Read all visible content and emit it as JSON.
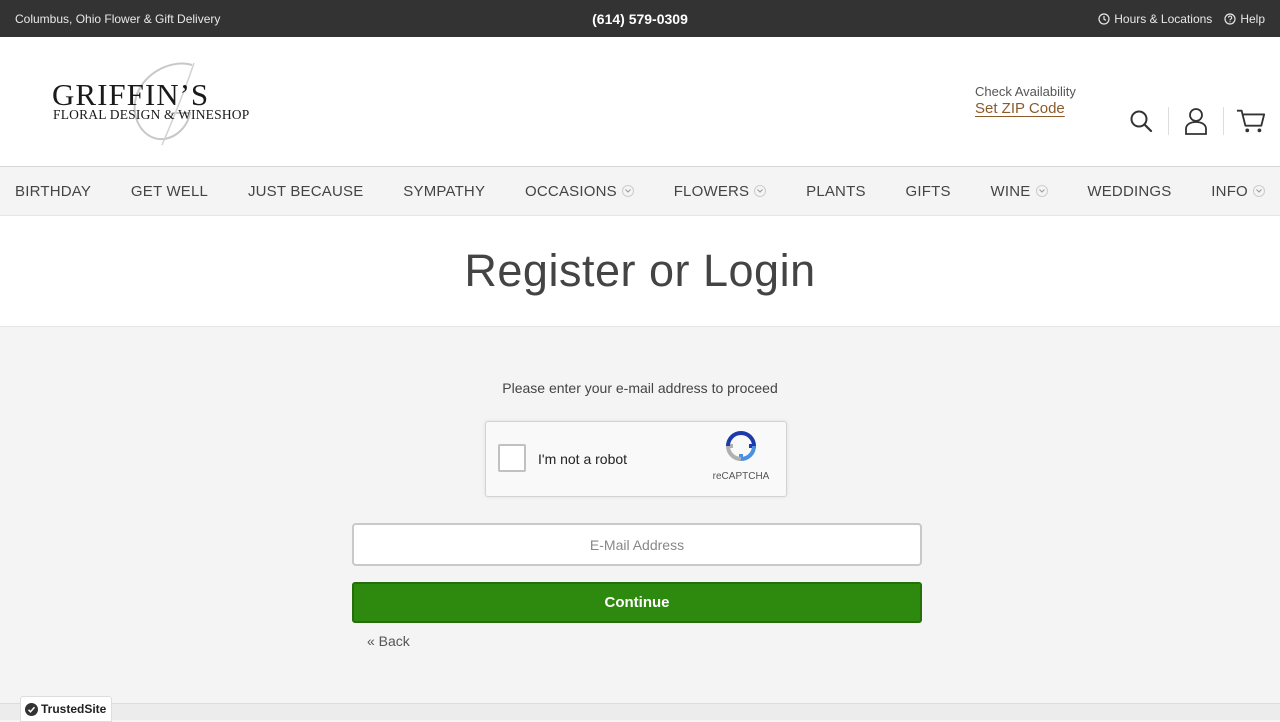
{
  "topbar": {
    "tagline": "Columbus, Ohio Flower & Gift Delivery",
    "phone": "(614) 579-0309",
    "hours_label": "Hours & Locations",
    "help_label": "Help"
  },
  "header": {
    "brand": "GRIFFIN’S",
    "brand_tagline": "FLORAL DESIGN & WINESHOP",
    "zip_label": "Check Availability",
    "zip_action": "Set ZIP Code",
    "icons": [
      "search-icon",
      "account-icon",
      "cart-icon"
    ]
  },
  "nav": {
    "items": [
      {
        "label": "BIRTHDAY",
        "dropdown": false
      },
      {
        "label": "GET WELL",
        "dropdown": false
      },
      {
        "label": "JUST BECAUSE",
        "dropdown": false
      },
      {
        "label": "SYMPATHY",
        "dropdown": false
      },
      {
        "label": "OCCASIONS",
        "dropdown": true
      },
      {
        "label": "FLOWERS",
        "dropdown": true
      },
      {
        "label": "PLANTS",
        "dropdown": false
      },
      {
        "label": "GIFTS",
        "dropdown": false
      },
      {
        "label": "WINE",
        "dropdown": true
      },
      {
        "label": "WEDDINGS",
        "dropdown": false
      },
      {
        "label": "INFO",
        "dropdown": true
      }
    ]
  },
  "page": {
    "title": "Register or Login",
    "prompt": "Please enter your e-mail address to proceed"
  },
  "recaptcha": {
    "label": "I'm not a robot",
    "brand": "reCAPTCHA"
  },
  "form": {
    "email_placeholder": "E-Mail Address",
    "email_value": "",
    "continue_label": "Continue",
    "back_label": "« Back"
  },
  "badge": {
    "label": "TrustedSite"
  },
  "colors": {
    "topbar": "#333333",
    "accent_link": "#8a5a2b",
    "continue_button": "#2e8a0e"
  }
}
